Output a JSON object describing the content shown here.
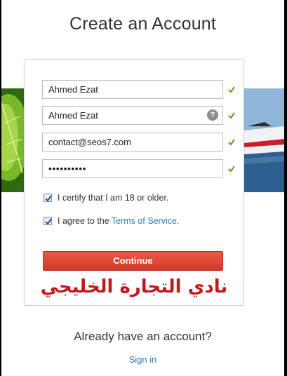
{
  "page": {
    "title": "Create an Account"
  },
  "form": {
    "first_name": {
      "value": "Ahmed Ezat",
      "valid": true
    },
    "last_name": {
      "value": "Ahmed Ezat",
      "valid": true,
      "help_label": "?"
    },
    "email": {
      "value": "contact@seos7.com",
      "valid": true
    },
    "password": {
      "value": "••••••••••",
      "valid": true
    },
    "age_checkbox": {
      "checked": true,
      "label": "I certify that I am 18 or older."
    },
    "tos_checkbox": {
      "checked": true,
      "label_prefix": "I agree to the ",
      "link_text": "Terms of Service",
      "label_suffix": "."
    },
    "continue_label": "Continue"
  },
  "watermark": {
    "text": "نادي التجارة الخليجي",
    "color": "#c41717"
  },
  "footer": {
    "already_text": "Already have an account?",
    "signin_label": "Sign in"
  },
  "colors": {
    "accent": "#d9412f",
    "link": "#2a7bb8",
    "valid_check": "#5a9a1a"
  },
  "icons": {
    "valid": "check-icon",
    "help": "help-icon",
    "checkbox": "checkbox-checked-icon"
  }
}
